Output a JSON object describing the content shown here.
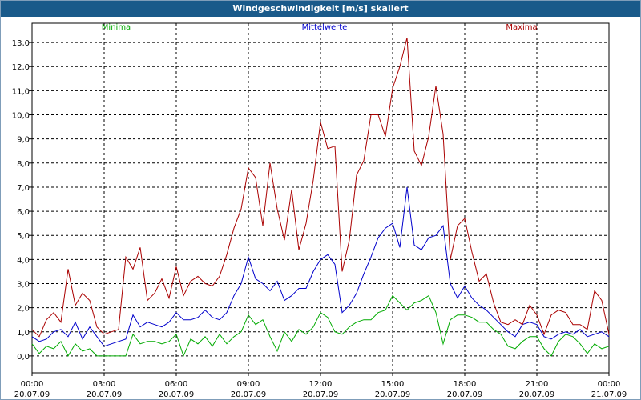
{
  "window": {
    "title": "Windgeschwindigkeit [m/s] skaliert"
  },
  "legend": {
    "min_label": "Minima",
    "mean_label": "Mittelwerte",
    "max_label": "Maxima"
  },
  "colors": {
    "min": "#00aa00",
    "mean": "#0000cc",
    "max": "#aa0000",
    "grid": "#000000",
    "titlebar": "#1a5a8a"
  },
  "chart_data": {
    "type": "line",
    "title": "Windgeschwindigkeit [m/s] skaliert",
    "xlabel": "",
    "ylabel": "",
    "ylim": [
      -0.7,
      13.8
    ],
    "xlim": [
      0,
      24
    ],
    "y_ticks": [
      "0,0",
      "1,0",
      "2,0",
      "3,0",
      "4,0",
      "5,0",
      "6,0",
      "7,0",
      "8,0",
      "9,0",
      "10,0",
      "11,0",
      "12,0",
      "13,0"
    ],
    "x_ticks": [
      {
        "time": "00:00",
        "date": "20.07.09"
      },
      {
        "time": "03:00",
        "date": "20.07.09"
      },
      {
        "time": "06:00",
        "date": "20.07.09"
      },
      {
        "time": "09:00",
        "date": "20.07.09"
      },
      {
        "time": "12:00",
        "date": "20.07.09"
      },
      {
        "time": "15:00",
        "date": "20.07.09"
      },
      {
        "time": "18:00",
        "date": "20.07.09"
      },
      {
        "time": "21:00",
        "date": "20.07.09"
      },
      {
        "time": "00:00",
        "date": "21.07.09"
      }
    ],
    "grid": true,
    "series": [
      {
        "name": "Minima",
        "x": [
          0,
          0.3,
          0.6,
          0.9,
          1.2,
          1.5,
          1.8,
          2.1,
          2.4,
          2.7,
          3.0,
          3.3,
          3.6,
          3.9,
          4.2,
          4.5,
          4.8,
          5.1,
          5.4,
          5.7,
          6.0,
          6.3,
          6.6,
          6.9,
          7.2,
          7.5,
          7.8,
          8.1,
          8.4,
          8.7,
          9.0,
          9.3,
          9.6,
          9.9,
          10.2,
          10.5,
          10.8,
          11.1,
          11.4,
          11.7,
          12.0,
          12.3,
          12.6,
          12.9,
          13.2,
          13.5,
          13.8,
          14.1,
          14.4,
          14.7,
          15.0,
          15.3,
          15.6,
          15.9,
          16.2,
          16.5,
          16.8,
          17.1,
          17.4,
          17.7,
          18.0,
          18.3,
          18.6,
          18.9,
          19.2,
          19.5,
          19.8,
          20.1,
          20.4,
          20.7,
          21.0,
          21.3,
          21.6,
          21.9,
          22.2,
          22.5,
          22.8,
          23.1,
          23.4,
          23.7,
          24.0
        ],
        "values": [
          0.5,
          0.1,
          0.4,
          0.3,
          0.6,
          0.0,
          0.5,
          0.2,
          0.3,
          0.0,
          0.0,
          0.0,
          0.0,
          0.0,
          0.9,
          0.5,
          0.6,
          0.6,
          0.5,
          0.6,
          0.9,
          0.0,
          0.7,
          0.5,
          0.8,
          0.4,
          0.9,
          0.5,
          0.8,
          1.0,
          1.7,
          1.3,
          1.5,
          0.8,
          0.2,
          1.0,
          0.6,
          1.1,
          0.9,
          1.2,
          1.8,
          1.6,
          1.0,
          0.9,
          1.2,
          1.4,
          1.5,
          1.5,
          1.8,
          1.9,
          2.5,
          2.2,
          1.9,
          2.2,
          2.3,
          2.5,
          1.8,
          0.5,
          1.5,
          1.7,
          1.7,
          1.6,
          1.4,
          1.4,
          1.1,
          0.9,
          0.4,
          0.3,
          0.6,
          0.8,
          0.8,
          0.3,
          0.0,
          0.6,
          0.9,
          0.8,
          0.5,
          0.1,
          0.5,
          0.3,
          0.4
        ]
      },
      {
        "name": "Mittelwerte",
        "x": [
          0,
          0.3,
          0.6,
          0.9,
          1.2,
          1.5,
          1.8,
          2.1,
          2.4,
          2.7,
          3.0,
          3.3,
          3.6,
          3.9,
          4.2,
          4.5,
          4.8,
          5.1,
          5.4,
          5.7,
          6.0,
          6.3,
          6.6,
          6.9,
          7.2,
          7.5,
          7.8,
          8.1,
          8.4,
          8.7,
          9.0,
          9.3,
          9.6,
          9.9,
          10.2,
          10.5,
          10.8,
          11.1,
          11.4,
          11.7,
          12.0,
          12.3,
          12.6,
          12.9,
          13.2,
          13.5,
          13.8,
          14.1,
          14.4,
          14.7,
          15.0,
          15.3,
          15.6,
          15.9,
          16.2,
          16.5,
          16.8,
          17.1,
          17.4,
          17.7,
          18.0,
          18.3,
          18.6,
          18.9,
          19.2,
          19.5,
          19.8,
          20.1,
          20.4,
          20.7,
          21.0,
          21.3,
          21.6,
          21.9,
          22.2,
          22.5,
          22.8,
          23.1,
          23.4,
          23.7,
          24.0
        ],
        "values": [
          0.8,
          0.6,
          0.7,
          1.0,
          1.1,
          0.8,
          1.4,
          0.7,
          1.2,
          0.8,
          0.4,
          0.5,
          0.6,
          0.7,
          1.7,
          1.2,
          1.4,
          1.3,
          1.2,
          1.4,
          1.8,
          1.5,
          1.5,
          1.6,
          1.9,
          1.6,
          1.5,
          1.8,
          2.5,
          3.0,
          4.1,
          3.2,
          3.0,
          2.7,
          3.1,
          2.3,
          2.5,
          2.8,
          2.8,
          3.5,
          4.0,
          4.2,
          3.8,
          1.8,
          2.1,
          2.6,
          3.4,
          4.1,
          4.9,
          5.3,
          5.5,
          4.5,
          7.0,
          4.6,
          4.4,
          4.9,
          5.0,
          5.4,
          3.0,
          2.4,
          2.9,
          2.4,
          2.1,
          1.9,
          1.6,
          1.3,
          1.0,
          0.8,
          1.3,
          1.4,
          1.3,
          0.8,
          0.7,
          0.9,
          1.0,
          0.9,
          1.1,
          0.8,
          0.9,
          1.0,
          0.8
        ]
      },
      {
        "name": "Maxima",
        "x": [
          0,
          0.3,
          0.6,
          0.9,
          1.2,
          1.5,
          1.8,
          2.1,
          2.4,
          2.7,
          3.0,
          3.3,
          3.6,
          3.9,
          4.2,
          4.5,
          4.8,
          5.1,
          5.4,
          5.7,
          6.0,
          6.3,
          6.6,
          6.9,
          7.2,
          7.5,
          7.8,
          8.1,
          8.4,
          8.7,
          9.0,
          9.3,
          9.6,
          9.9,
          10.2,
          10.5,
          10.8,
          11.1,
          11.4,
          11.7,
          12.0,
          12.3,
          12.6,
          12.9,
          13.2,
          13.5,
          13.8,
          14.1,
          14.4,
          14.7,
          15.0,
          15.3,
          15.6,
          15.9,
          16.2,
          16.5,
          16.8,
          17.1,
          17.4,
          17.7,
          18.0,
          18.3,
          18.6,
          18.9,
          19.2,
          19.5,
          19.8,
          20.1,
          20.4,
          20.7,
          21.0,
          21.3,
          21.6,
          21.9,
          22.2,
          22.5,
          22.8,
          23.1,
          23.4,
          23.7,
          24.0
        ],
        "values": [
          1.1,
          0.8,
          1.5,
          1.8,
          1.4,
          3.6,
          2.1,
          2.6,
          2.3,
          1.2,
          0.9,
          1.0,
          1.1,
          4.1,
          3.6,
          4.5,
          2.3,
          2.6,
          3.2,
          2.4,
          3.7,
          2.5,
          3.1,
          3.3,
          3.0,
          2.9,
          3.3,
          4.2,
          5.3,
          6.1,
          7.8,
          7.4,
          5.4,
          8.0,
          6.1,
          4.8,
          6.9,
          4.4,
          5.5,
          7.3,
          9.7,
          8.6,
          8.7,
          3.5,
          4.8,
          7.5,
          8.1,
          10.0,
          10.0,
          9.1,
          11.1,
          12.0,
          13.2,
          8.5,
          7.9,
          9.1,
          11.2,
          9.2,
          4.0,
          5.4,
          5.7,
          4.3,
          3.1,
          3.4,
          2.2,
          1.4,
          1.3,
          1.5,
          1.3,
          2.1,
          1.7,
          0.9,
          1.7,
          1.9,
          1.8,
          1.3,
          1.3,
          1.1,
          2.7,
          2.3,
          0.9
        ]
      }
    ]
  }
}
